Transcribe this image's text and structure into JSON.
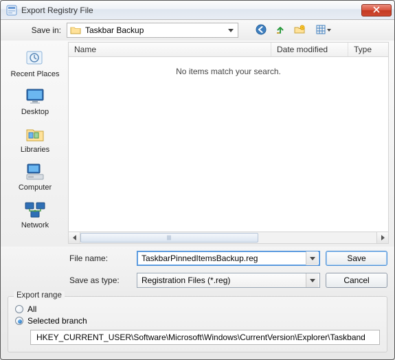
{
  "window": {
    "title": "Export Registry File"
  },
  "toolbar": {
    "savein_label": "Save in:",
    "savein_value": "Taskbar Backup",
    "icons": {
      "back": "back-icon",
      "up": "up-one-level-icon",
      "newfolder": "new-folder-icon",
      "view": "view-menu-icon"
    }
  },
  "sidebar": {
    "items": [
      {
        "id": "recent",
        "label": "Recent Places"
      },
      {
        "id": "desktop",
        "label": "Desktop"
      },
      {
        "id": "libraries",
        "label": "Libraries"
      },
      {
        "id": "computer",
        "label": "Computer"
      },
      {
        "id": "network",
        "label": "Network"
      }
    ]
  },
  "list": {
    "columns": {
      "name": "Name",
      "date": "Date modified",
      "type": "Type"
    },
    "empty_message": "No items match your search."
  },
  "fields": {
    "filename_label": "File name:",
    "filename_value": "TaskbarPinnedItemsBackup.reg",
    "savetype_label": "Save as type:",
    "savetype_value": "Registration Files (*.reg)"
  },
  "buttons": {
    "save": "Save",
    "cancel": "Cancel"
  },
  "export_range": {
    "legend": "Export range",
    "all_label": "All",
    "selected_label": "Selected branch",
    "selected_checked": true,
    "branch_path": "HKEY_CURRENT_USER\\Software\\Microsoft\\Windows\\CurrentVersion\\Explorer\\Taskband"
  }
}
